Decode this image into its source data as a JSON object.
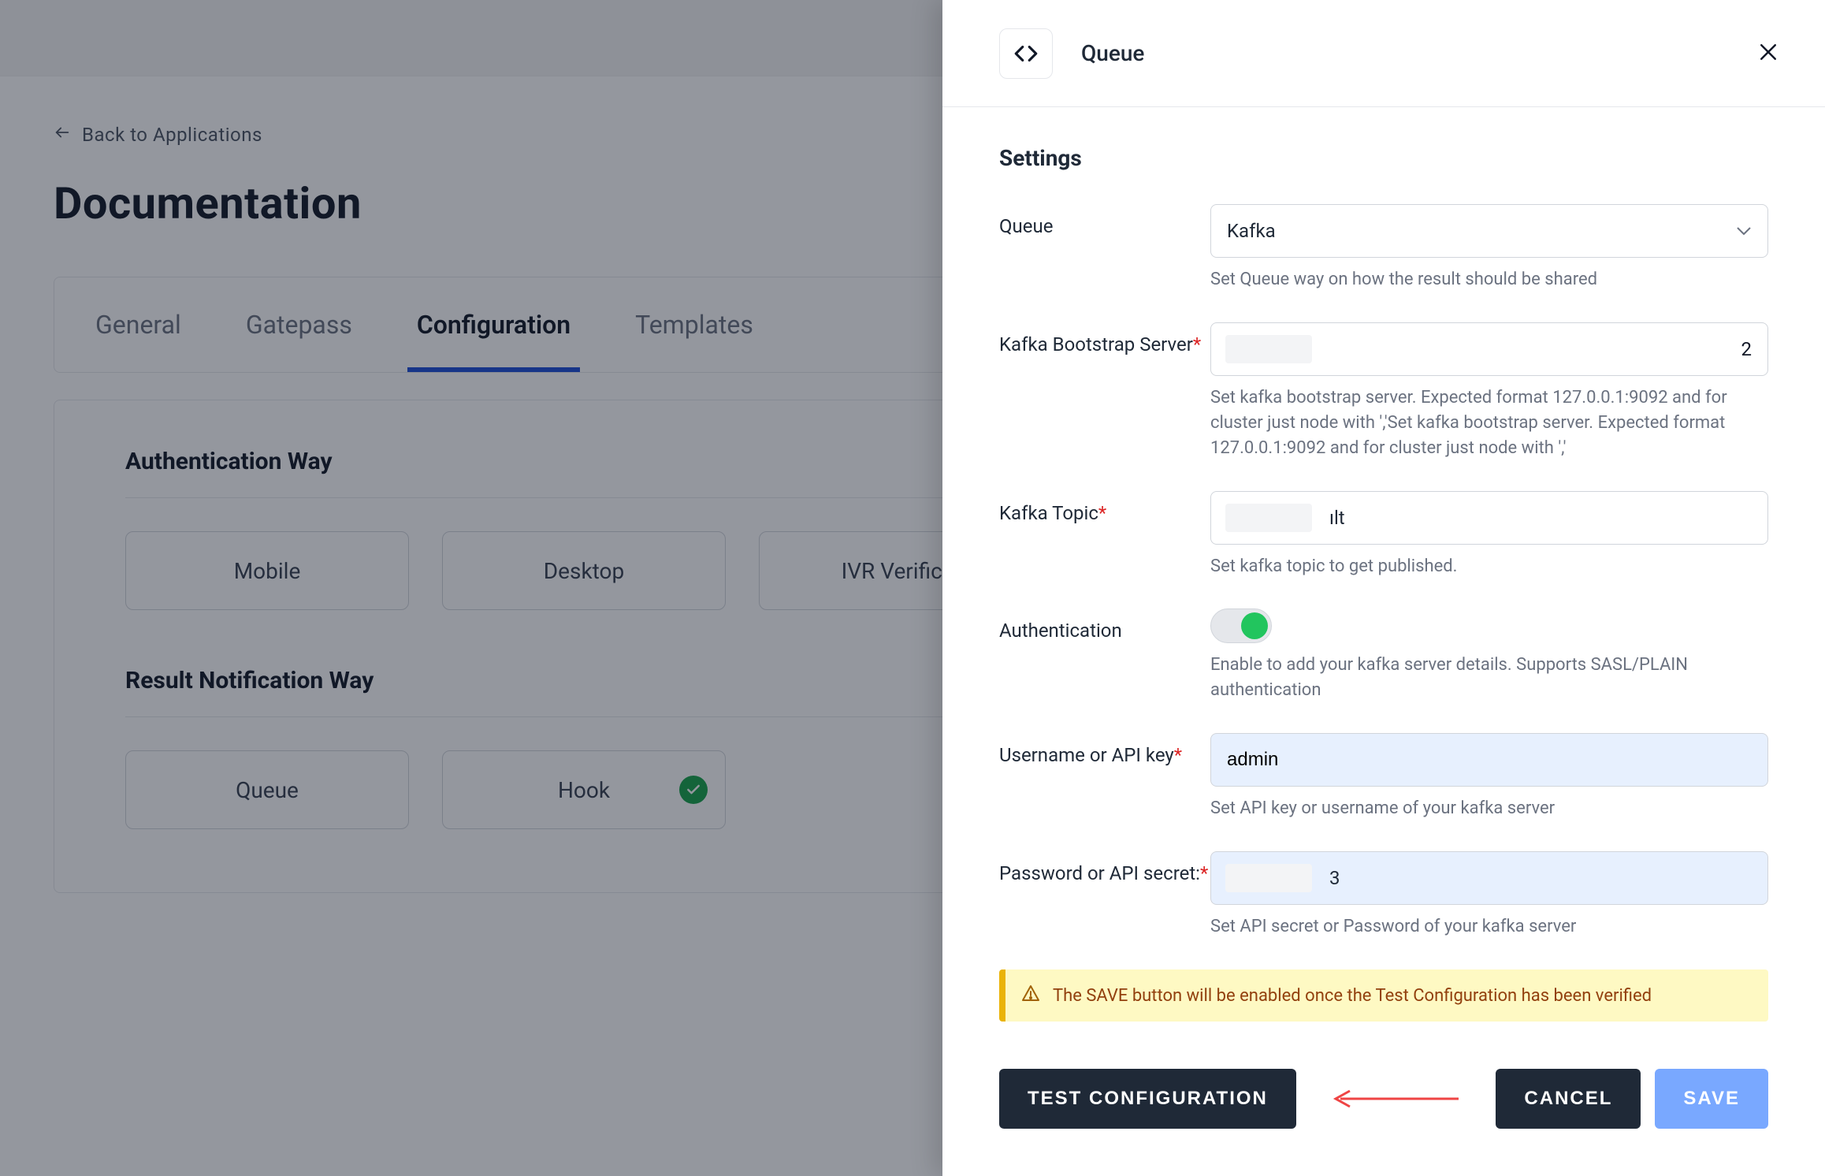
{
  "page": {
    "back_label": "Back to Applications",
    "title": "Documentation"
  },
  "tabs": {
    "items": [
      "General",
      "Gatepass",
      "Configuration",
      "Templates"
    ],
    "active_index": 2
  },
  "content": {
    "auth_section_title": "Authentication Way",
    "auth_options": [
      "Mobile",
      "Desktop",
      "IVR Verification"
    ],
    "result_section_title": "Result Notification Way",
    "result_options": [
      "Queue",
      "Hook"
    ],
    "result_checked_index": 1
  },
  "drawer": {
    "title": "Queue",
    "settings_title": "Settings",
    "fields": {
      "queue": {
        "label": "Queue",
        "value": "Kafka",
        "helper": "Set Queue way on how the result should be shared"
      },
      "bootstrap": {
        "label": "Kafka Bootstrap Server",
        "required": true,
        "value_tail": "2",
        "helper": "Set kafka bootstrap server. Expected format 127.0.0.1:9092 and for cluster just node with ','Set kafka bootstrap server. Expected format 127.0.0.1:9092 and for cluster just node with ','"
      },
      "topic": {
        "label": "Kafka Topic",
        "required": true,
        "value_tail": "ılt",
        "helper": "Set kafka topic to get published."
      },
      "auth": {
        "label": "Authentication",
        "on": true,
        "helper": "Enable to add your kafka server details. Supports SASL/PLAIN authentication"
      },
      "username": {
        "label": "Username or API key",
        "required": true,
        "value": "admin",
        "helper": "Set API key or username of your kafka server"
      },
      "password": {
        "label": "Password or API secret:",
        "required": true,
        "value_tail": "3",
        "helper": "Set API secret or Password of your kafka server"
      }
    },
    "banner": "The SAVE button will be enabled once the Test Configuration has been verified",
    "buttons": {
      "test": "TEST CONFIGURATION",
      "cancel": "CANCEL",
      "save": "SAVE"
    }
  },
  "colors": {
    "primary": "#1d4ed8",
    "success": "#16a34a",
    "warning_bg": "#fef9c3",
    "warning_border": "#eab308"
  }
}
